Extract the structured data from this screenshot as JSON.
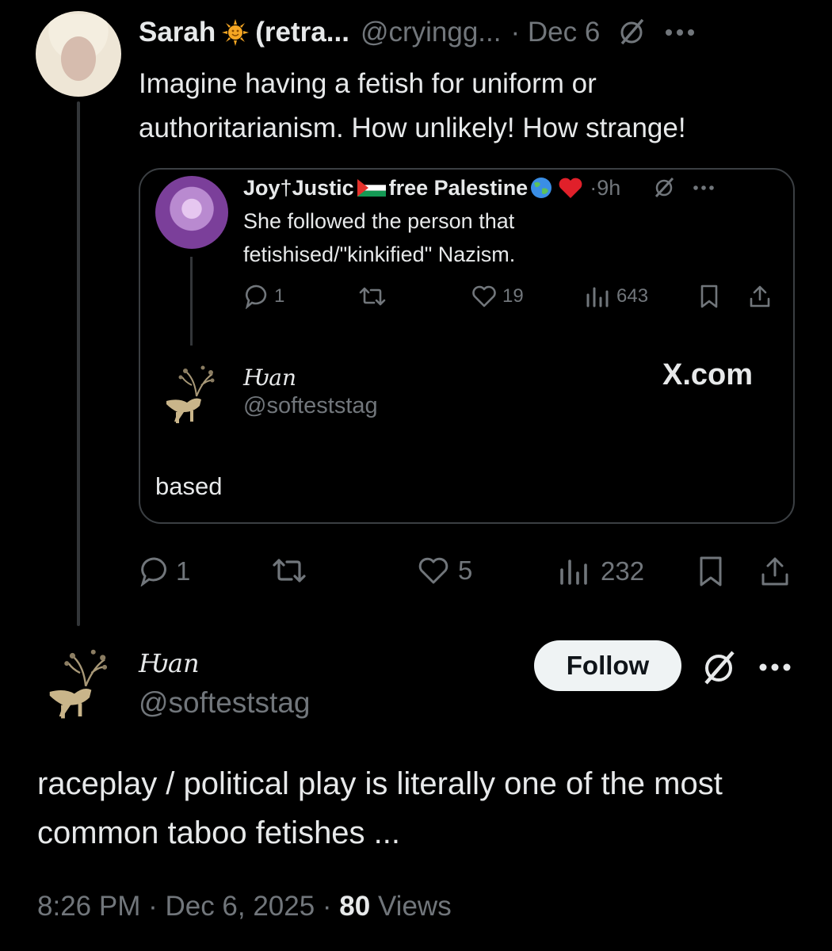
{
  "post": {
    "author_name": "Sarah",
    "author_suffix": "(retra...",
    "handle": "@cryingg...",
    "date": "· Dec 6",
    "text": "Imagine having a fetish for uniform or authoritarianism. How unlikely! How strange!",
    "stats": {
      "replies": "1",
      "likes": "5",
      "views": "232"
    }
  },
  "quoted": {
    "author_name_a": "Joy",
    "author_name_b": "Justic",
    "author_name_c": "free Palestine",
    "time": "·9h",
    "text": "She followed the person that fetishised/\"kinkified\" Nazism.",
    "stats": {
      "replies": "1",
      "likes": "19",
      "views": "643"
    },
    "embed": {
      "name": "Ƕan",
      "handle": "@softeststag",
      "site": "X.com"
    },
    "reply_text": "based"
  },
  "reply": {
    "author_name": "Ƕan",
    "handle": "@softeststag",
    "follow_label": "Follow",
    "text": "raceplay / political play is literally one of the most common taboo fetishes  ...",
    "timestamp": "8:26 PM · Dec 6, 2025 · ",
    "views_count": "80",
    "views_label": " Views"
  },
  "colors": {
    "background": "#000000",
    "text": "#e7e9ea",
    "muted": "#71767b",
    "border": "#3b3f43",
    "follow_bg": "#eff3f4"
  }
}
